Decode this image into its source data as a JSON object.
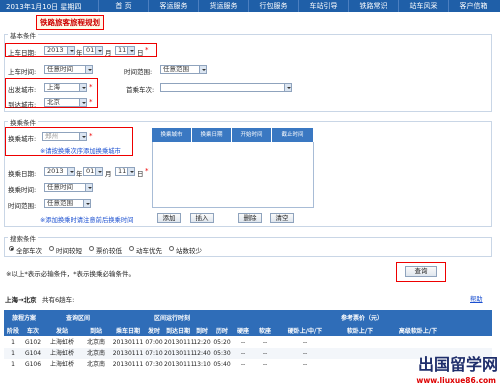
{
  "topbar": {
    "date": "2013年1月10日 星期四",
    "nav": [
      "首 页",
      "客运服务",
      "货运服务",
      "行包服务",
      "车站引导",
      "铁路常识",
      "站车风采",
      "客户信箱"
    ]
  },
  "page_title": "铁路旅客旅程规划",
  "basic": {
    "section_title": "基本条件",
    "depart_date_label": "上车日期:",
    "year": "2013",
    "month": "01",
    "day": "11",
    "year_unit": "年",
    "month_unit": "月",
    "day_unit": "日",
    "board_time_label": "上车时间:",
    "board_time_value": "任意时间",
    "time_range_label": "时间范围:",
    "time_range_value": "任意范围",
    "from_label": "出发城市:",
    "from_value": "上海",
    "to_label": "到达城市:",
    "to_value": "北京",
    "preferred_label": "首乘车次:",
    "preferred_value": ""
  },
  "transfer": {
    "section_title": "换乘条件",
    "city_label": "换乘城市:",
    "city_placeholder": "郑州",
    "hint_order": "※请按换乘次序添加换乘城市",
    "columns": [
      "换乘城市",
      "换乘日期",
      "开始时间",
      "截止时间"
    ],
    "date_label": "换乘日期:",
    "year": "2013",
    "month": "01",
    "day": "11",
    "year_unit": "年",
    "month_unit": "月",
    "day_unit": "日",
    "time_label": "换乘时间:",
    "time_value": "任意时间",
    "range_label": "时间范围:",
    "range_value": "任意范围",
    "hint_add": "※添加换乘时请注意前后换乘时间",
    "buttons": {
      "add": "添加",
      "insert": "插入",
      "delete": "删除",
      "clear": "清空"
    }
  },
  "search": {
    "section_title": "搜索条件",
    "options": [
      "全部车次",
      "时间较短",
      "票价较低",
      "动车优先",
      "站数较少"
    ],
    "required_note": "※以上*表示必输条件，*表示换乘必输条件。",
    "query_button": "查询"
  },
  "results": {
    "route": "上海→北京",
    "count": "共有6趟车:",
    "help": "帮助",
    "header_groups": {
      "plan": "旅程方案",
      "query_section": "查询区间",
      "run_section": "区间运行时刻",
      "ref_price": "参考票价（元）"
    },
    "columns": [
      "阶段",
      "车次",
      "发站",
      "到站",
      "乘车日期",
      "发时",
      "到达日期",
      "到时",
      "历时",
      "硬座",
      "软座",
      "硬卧上/中/下",
      "软卧上/下",
      "高级软卧上/下"
    ],
    "rows": [
      {
        "stage": "1",
        "train": "G102",
        "from": "上海虹桥",
        "to": "北京南",
        "date": "20130111",
        "dep": "07:00",
        "arr_date": "20130111",
        "arr": "12:20",
        "dur": "05:20"
      },
      {
        "stage": "1",
        "train": "G104",
        "from": "上海虹桥",
        "to": "北京南",
        "date": "20130111",
        "dep": "07:10",
        "arr_date": "20130111",
        "arr": "12:40",
        "dur": "05:30"
      },
      {
        "stage": "1",
        "train": "G106",
        "from": "上海虹桥",
        "to": "北京南",
        "date": "20130111",
        "dep": "07:30",
        "arr_date": "20130111",
        "arr": "13:10",
        "dur": "05:40"
      }
    ],
    "price_placeholder": "--"
  },
  "watermark": {
    "main": "出国留学网",
    "url": "www.liuxue86.com"
  },
  "colors": {
    "topbar": "#1f5fa8",
    "header": "#2f6db8",
    "highlight": "#e00000",
    "link": "#1a4fd0"
  }
}
